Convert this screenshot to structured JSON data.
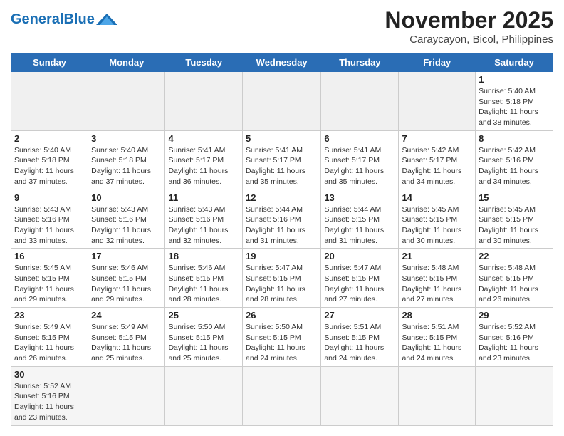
{
  "header": {
    "logo_general": "General",
    "logo_blue": "Blue",
    "month_title": "November 2025",
    "location": "Caraycayon, Bicol, Philippines"
  },
  "days_of_week": [
    "Sunday",
    "Monday",
    "Tuesday",
    "Wednesday",
    "Thursday",
    "Friday",
    "Saturday"
  ],
  "weeks": [
    [
      {
        "day": "",
        "info": ""
      },
      {
        "day": "",
        "info": ""
      },
      {
        "day": "",
        "info": ""
      },
      {
        "day": "",
        "info": ""
      },
      {
        "day": "",
        "info": ""
      },
      {
        "day": "",
        "info": ""
      },
      {
        "day": "1",
        "info": "Sunrise: 5:40 AM\nSunset: 5:18 PM\nDaylight: 11 hours\nand 38 minutes."
      }
    ],
    [
      {
        "day": "2",
        "info": "Sunrise: 5:40 AM\nSunset: 5:18 PM\nDaylight: 11 hours\nand 37 minutes."
      },
      {
        "day": "3",
        "info": "Sunrise: 5:40 AM\nSunset: 5:18 PM\nDaylight: 11 hours\nand 37 minutes."
      },
      {
        "day": "4",
        "info": "Sunrise: 5:41 AM\nSunset: 5:17 PM\nDaylight: 11 hours\nand 36 minutes."
      },
      {
        "day": "5",
        "info": "Sunrise: 5:41 AM\nSunset: 5:17 PM\nDaylight: 11 hours\nand 35 minutes."
      },
      {
        "day": "6",
        "info": "Sunrise: 5:41 AM\nSunset: 5:17 PM\nDaylight: 11 hours\nand 35 minutes."
      },
      {
        "day": "7",
        "info": "Sunrise: 5:42 AM\nSunset: 5:17 PM\nDaylight: 11 hours\nand 34 minutes."
      },
      {
        "day": "8",
        "info": "Sunrise: 5:42 AM\nSunset: 5:16 PM\nDaylight: 11 hours\nand 34 minutes."
      }
    ],
    [
      {
        "day": "9",
        "info": "Sunrise: 5:43 AM\nSunset: 5:16 PM\nDaylight: 11 hours\nand 33 minutes."
      },
      {
        "day": "10",
        "info": "Sunrise: 5:43 AM\nSunset: 5:16 PM\nDaylight: 11 hours\nand 32 minutes."
      },
      {
        "day": "11",
        "info": "Sunrise: 5:43 AM\nSunset: 5:16 PM\nDaylight: 11 hours\nand 32 minutes."
      },
      {
        "day": "12",
        "info": "Sunrise: 5:44 AM\nSunset: 5:16 PM\nDaylight: 11 hours\nand 31 minutes."
      },
      {
        "day": "13",
        "info": "Sunrise: 5:44 AM\nSunset: 5:15 PM\nDaylight: 11 hours\nand 31 minutes."
      },
      {
        "day": "14",
        "info": "Sunrise: 5:45 AM\nSunset: 5:15 PM\nDaylight: 11 hours\nand 30 minutes."
      },
      {
        "day": "15",
        "info": "Sunrise: 5:45 AM\nSunset: 5:15 PM\nDaylight: 11 hours\nand 30 minutes."
      }
    ],
    [
      {
        "day": "16",
        "info": "Sunrise: 5:45 AM\nSunset: 5:15 PM\nDaylight: 11 hours\nand 29 minutes."
      },
      {
        "day": "17",
        "info": "Sunrise: 5:46 AM\nSunset: 5:15 PM\nDaylight: 11 hours\nand 29 minutes."
      },
      {
        "day": "18",
        "info": "Sunrise: 5:46 AM\nSunset: 5:15 PM\nDaylight: 11 hours\nand 28 minutes."
      },
      {
        "day": "19",
        "info": "Sunrise: 5:47 AM\nSunset: 5:15 PM\nDaylight: 11 hours\nand 28 minutes."
      },
      {
        "day": "20",
        "info": "Sunrise: 5:47 AM\nSunset: 5:15 PM\nDaylight: 11 hours\nand 27 minutes."
      },
      {
        "day": "21",
        "info": "Sunrise: 5:48 AM\nSunset: 5:15 PM\nDaylight: 11 hours\nand 27 minutes."
      },
      {
        "day": "22",
        "info": "Sunrise: 5:48 AM\nSunset: 5:15 PM\nDaylight: 11 hours\nand 26 minutes."
      }
    ],
    [
      {
        "day": "23",
        "info": "Sunrise: 5:49 AM\nSunset: 5:15 PM\nDaylight: 11 hours\nand 26 minutes."
      },
      {
        "day": "24",
        "info": "Sunrise: 5:49 AM\nSunset: 5:15 PM\nDaylight: 11 hours\nand 25 minutes."
      },
      {
        "day": "25",
        "info": "Sunrise: 5:50 AM\nSunset: 5:15 PM\nDaylight: 11 hours\nand 25 minutes."
      },
      {
        "day": "26",
        "info": "Sunrise: 5:50 AM\nSunset: 5:15 PM\nDaylight: 11 hours\nand 24 minutes."
      },
      {
        "day": "27",
        "info": "Sunrise: 5:51 AM\nSunset: 5:15 PM\nDaylight: 11 hours\nand 24 minutes."
      },
      {
        "day": "28",
        "info": "Sunrise: 5:51 AM\nSunset: 5:15 PM\nDaylight: 11 hours\nand 24 minutes."
      },
      {
        "day": "29",
        "info": "Sunrise: 5:52 AM\nSunset: 5:16 PM\nDaylight: 11 hours\nand 23 minutes."
      }
    ],
    [
      {
        "day": "30",
        "info": "Sunrise: 5:52 AM\nSunset: 5:16 PM\nDaylight: 11 hours\nand 23 minutes."
      },
      {
        "day": "",
        "info": ""
      },
      {
        "day": "",
        "info": ""
      },
      {
        "day": "",
        "info": ""
      },
      {
        "day": "",
        "info": ""
      },
      {
        "day": "",
        "info": ""
      },
      {
        "day": "",
        "info": ""
      }
    ]
  ]
}
